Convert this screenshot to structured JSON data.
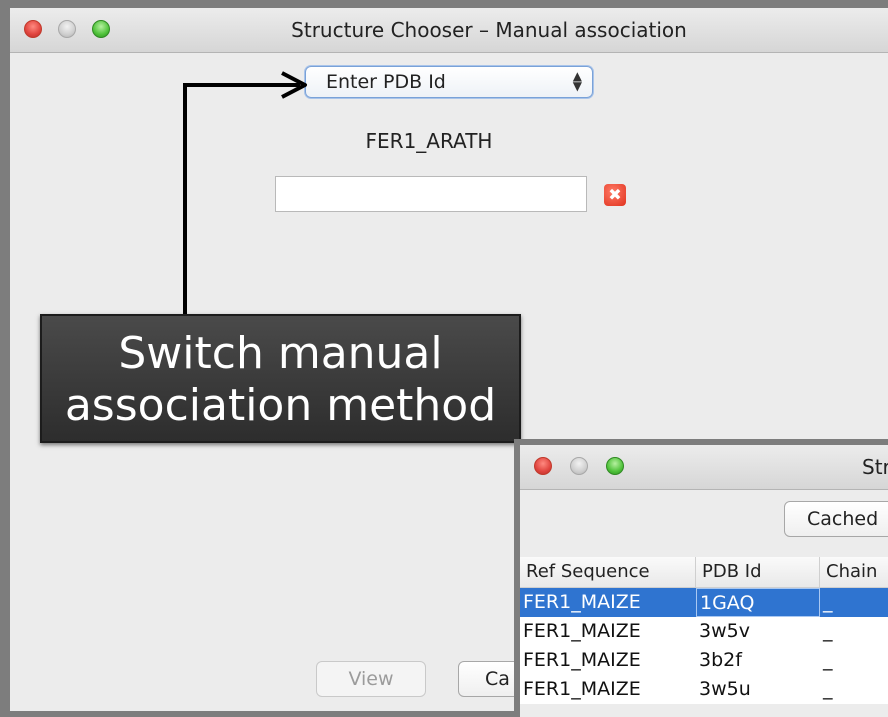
{
  "main_window": {
    "title": "Structure Chooser – Manual association",
    "method_select": {
      "value": "Enter PDB Id",
      "arrows": "▲▼"
    },
    "sequence_name": "FER1_ARATH",
    "pdb_id_input": {
      "value": "",
      "placeholder": ""
    },
    "clear_icon": "✖",
    "buttons": {
      "view": "View",
      "cancel": "Ca"
    }
  },
  "callout": {
    "line1": "Switch manual",
    "line2": "association method"
  },
  "second_window": {
    "title": "Str",
    "cached_button": "Cached",
    "table": {
      "columns": [
        "Ref Sequence",
        "PDB Id",
        "Chain"
      ],
      "rows": [
        {
          "ref": "FER1_MAIZE",
          "pdb": "1GAQ",
          "chain": "_",
          "selected": true
        },
        {
          "ref": "FER1_MAIZE",
          "pdb": "3w5v",
          "chain": "_",
          "selected": false
        },
        {
          "ref": "FER1_MAIZE",
          "pdb": "3b2f",
          "chain": "_",
          "selected": false
        },
        {
          "ref": "FER1_MAIZE",
          "pdb": "3w5u",
          "chain": "_",
          "selected": false
        }
      ]
    }
  },
  "colors": {
    "selection": "#2f74d0",
    "callout_bg": "#3a3a3a",
    "focus_ring": "#7aa2d8"
  }
}
